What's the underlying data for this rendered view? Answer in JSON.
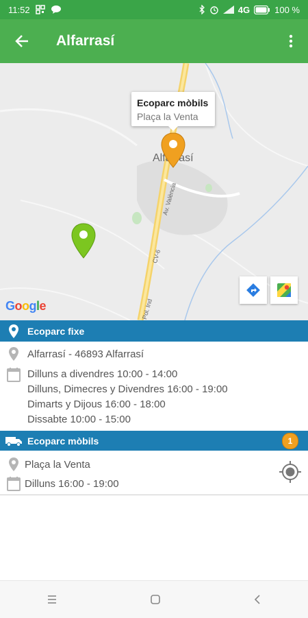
{
  "status_bar": {
    "time": "11:52",
    "network": "4G",
    "battery": "100 %"
  },
  "toolbar": {
    "title": "Alfarrasí"
  },
  "map": {
    "callout_title": "Ecoparc mòbils",
    "callout_subtitle": "Plaça la Venta",
    "town_label": "Alfarrasí",
    "road_label_1": "Av. València",
    "road_label_2": "CV-6",
    "road_label_3": "Pol. Ind",
    "google_logo": "Google",
    "marker_orange_color": "#f0a020",
    "marker_green_color": "#7cc620"
  },
  "fixed_section": {
    "header": "Ecoparc fixe",
    "address": "Alfarrasí - 46893 Alfarrasí",
    "hours": [
      "Dilluns a divendres 10:00 - 14:00",
      "Dilluns, Dimecres y Divendres 16:00 - 19:00",
      "Dimarts y Dijous 16:00 - 18:00",
      "Dissabte 10:00 - 15:00"
    ]
  },
  "mobile_section": {
    "header": "Ecoparc mòbils",
    "badge_count": "1",
    "items": [
      {
        "location": "Plaça la Venta",
        "schedule": "Dilluns 16:00 - 19:00"
      }
    ]
  },
  "colors": {
    "toolbar_green": "#4caf50",
    "status_green": "#3aa548",
    "section_blue": "#1d7eb3"
  }
}
